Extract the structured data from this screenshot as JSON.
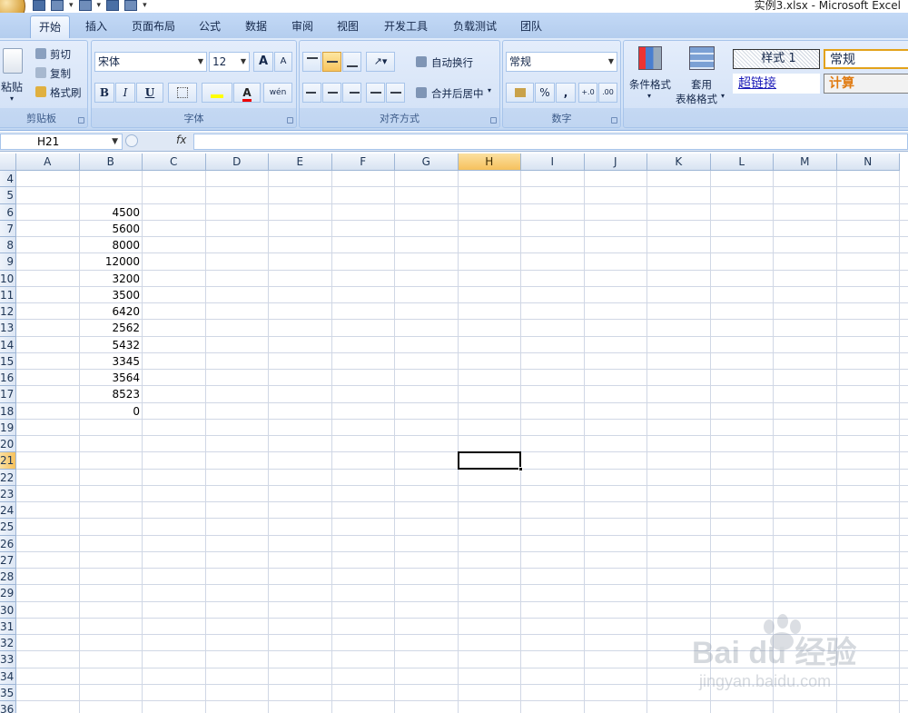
{
  "window": {
    "title": "实例3.xlsx - Microsoft Excel"
  },
  "tabs": [
    {
      "label": "开始",
      "active": true
    },
    {
      "label": "插入"
    },
    {
      "label": "页面布局"
    },
    {
      "label": "公式"
    },
    {
      "label": "数据"
    },
    {
      "label": "审阅"
    },
    {
      "label": "视图"
    },
    {
      "label": "开发工具"
    },
    {
      "label": "负载测试"
    },
    {
      "label": "团队"
    }
  ],
  "clipboard": {
    "paste": "粘贴",
    "cut": "剪切",
    "copy": "复制",
    "format_painter": "格式刷",
    "group": "剪贴板"
  },
  "font": {
    "name": "宋体",
    "size": "12",
    "grow": "A",
    "shrink": "A",
    "bold": "B",
    "italic": "I",
    "underline": "U",
    "color_letter": "A",
    "phonetic": "wén",
    "group": "字体"
  },
  "alignment": {
    "wrap": "自动换行",
    "merge": "合并后居中",
    "group": "对齐方式"
  },
  "number": {
    "format": "常规",
    "percent": "%",
    "comma": ",",
    "inc": "+.0",
    "dec": ".00",
    "group": "数字"
  },
  "styles_group": {
    "conditional": "条件格式",
    "table_line1": "套用",
    "table_line2": "表格格式",
    "style1": "样式 1",
    "normal": "常规",
    "hyperlink": "超链接",
    "calc": "计算"
  },
  "formula_bar": {
    "name_box": "H21",
    "fx": "fx"
  },
  "grid": {
    "columns": [
      "A",
      "B",
      "C",
      "D",
      "E",
      "F",
      "G",
      "H",
      "I",
      "J",
      "K",
      "L",
      "M",
      "N"
    ],
    "active_column": "H",
    "rows": [
      "4",
      "5",
      "6",
      "7",
      "8",
      "9",
      "10",
      "11",
      "12",
      "13",
      "14",
      "15",
      "16",
      "17",
      "18",
      "19",
      "20",
      "21",
      "22",
      "23",
      "24",
      "25",
      "26",
      "27",
      "28",
      "29",
      "30",
      "31",
      "32",
      "33",
      "34",
      "35",
      "36"
    ],
    "active_row": "21",
    "cells": [
      {
        "ref": "B6",
        "value": "4500"
      },
      {
        "ref": "B7",
        "value": "5600"
      },
      {
        "ref": "B8",
        "value": "8000"
      },
      {
        "ref": "B9",
        "value": "12000"
      },
      {
        "ref": "B10",
        "value": "3200"
      },
      {
        "ref": "B11",
        "value": "3500"
      },
      {
        "ref": "B12",
        "value": "6420"
      },
      {
        "ref": "B13",
        "value": "2562"
      },
      {
        "ref": "B14",
        "value": "5432"
      },
      {
        "ref": "B15",
        "value": "3345"
      },
      {
        "ref": "B16",
        "value": "3564"
      },
      {
        "ref": "B17",
        "value": "8523"
      },
      {
        "ref": "B18",
        "value": "0"
      }
    ]
  },
  "watermark": {
    "brand": "Bai du 经验",
    "url": "jingyan.baidu.com"
  },
  "colors": {
    "accent": "#f6c15d",
    "ribbon": "#dfeafa",
    "header": "#dbe5f3",
    "calc_text": "#e07a10",
    "link": "#1a1ab8"
  }
}
